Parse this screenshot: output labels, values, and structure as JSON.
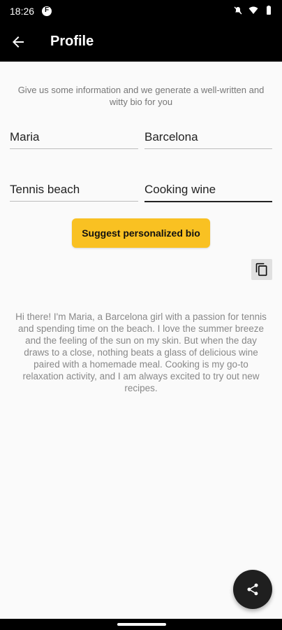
{
  "status_bar": {
    "time": "18:26",
    "icons": [
      "notification-app-icon",
      "mute-icon",
      "wifi-icon",
      "battery-icon"
    ]
  },
  "app_bar": {
    "title": "Profile",
    "back_icon": "arrow-back-icon"
  },
  "intro": {
    "text": "Give us some information and we generate a well-written and witty bio for you"
  },
  "form": {
    "name": "Maria",
    "city": "Barcelona",
    "hobby": "Tennis beach",
    "interest": "Cooking wine"
  },
  "actions": {
    "suggest_label": "Suggest personalized bio",
    "copy_icon": "copy-icon"
  },
  "bio": {
    "text": "Hi there! I'm Maria, a Barcelona girl with a passion for tennis and spending time on the beach. I love the summer breeze and the feeling of the sun on my skin. But when the day draws to a close, nothing beats a glass of delicious wine paired with a homemade meal. Cooking is my go-to relaxation activity, and I am always excited to try out new recipes."
  },
  "fab": {
    "icon": "share-icon"
  },
  "colors": {
    "accent": "#f9c122",
    "appbar": "#000000",
    "background": "#fafafa"
  }
}
